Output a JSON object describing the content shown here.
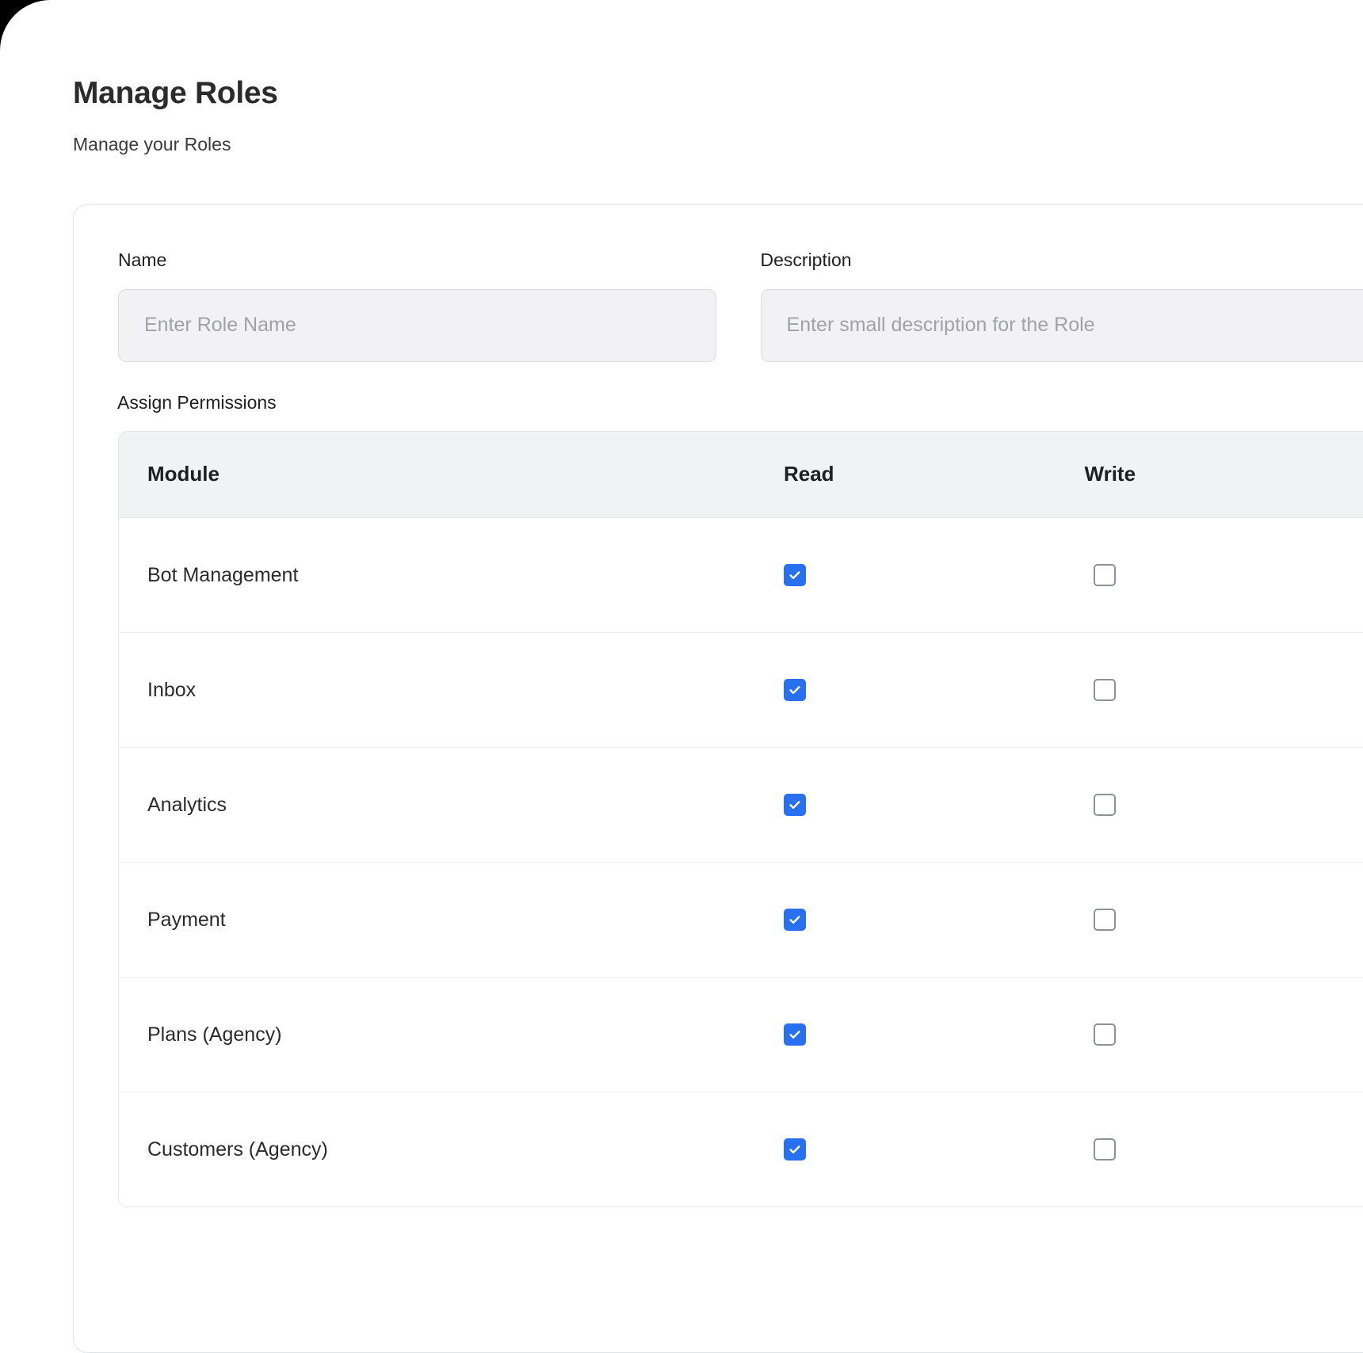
{
  "page": {
    "title": "Manage Roles",
    "subtitle": "Manage your Roles"
  },
  "form": {
    "name": {
      "label": "Name",
      "placeholder": "Enter Role Name",
      "value": ""
    },
    "description": {
      "label": "Description",
      "placeholder": "Enter small description for the Role",
      "value": ""
    }
  },
  "permissions": {
    "section_label": "Assign Permissions",
    "columns": [
      {
        "key": "module",
        "label": "Module"
      },
      {
        "key": "read",
        "label": "Read"
      },
      {
        "key": "write",
        "label": "Write"
      }
    ],
    "rows": [
      {
        "module": "Bot Management",
        "read": true,
        "write": false
      },
      {
        "module": "Inbox",
        "read": true,
        "write": false
      },
      {
        "module": "Analytics",
        "read": true,
        "write": false
      },
      {
        "module": "Payment",
        "read": true,
        "write": false
      },
      {
        "module": "Plans (Agency)",
        "read": true,
        "write": false
      },
      {
        "module": "Customers (Agency)",
        "read": true,
        "write": false
      }
    ]
  },
  "colors": {
    "checkbox_checked": "#2970f0",
    "checkbox_border": "#8e9196",
    "table_header_bg": "#f1f2f4",
    "input_bg": "#f2f2f4",
    "text_primary": "#1f1f1f",
    "placeholder": "#a0a2a7"
  }
}
